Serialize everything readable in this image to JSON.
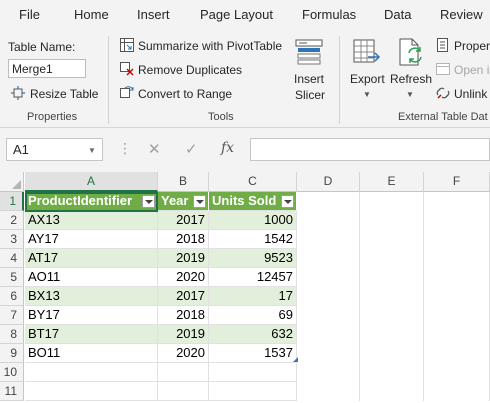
{
  "menu": {
    "file": "File",
    "home": "Home",
    "insert": "Insert",
    "page_layout": "Page Layout",
    "formulas": "Formulas",
    "data": "Data",
    "review": "Review"
  },
  "ribbon": {
    "properties": {
      "table_name_label": "Table Name:",
      "table_name_value": "Merge1",
      "resize_table": "Resize Table",
      "group_label": "Properties"
    },
    "tools": {
      "summarize": "Summarize with PivotTable",
      "remove_duplicates": "Remove Duplicates",
      "convert_to_range": "Convert to Range",
      "insert_slicer_line1": "Insert",
      "insert_slicer_line2": "Slicer",
      "group_label": "Tools"
    },
    "external": {
      "export": "Export",
      "refresh": "Refresh",
      "properties": "Proper",
      "open_in": "Open i",
      "unlink": "Unlink",
      "group_label": "External Table Dat"
    }
  },
  "formula_bar": {
    "name_box": "A1",
    "fx": "fx",
    "formula": ""
  },
  "grid": {
    "columns": [
      "A",
      "B",
      "C",
      "D",
      "E",
      "F"
    ],
    "rows": [
      "1",
      "2",
      "3",
      "4",
      "5",
      "6",
      "7",
      "8",
      "9",
      "10",
      "11"
    ],
    "table_headers": [
      "ProductIdentifier",
      "Year",
      "Units Sold"
    ],
    "table_rows": [
      [
        "AX13",
        "2017",
        "1000"
      ],
      [
        "AY17",
        "2018",
        "1542"
      ],
      [
        "AT17",
        "2019",
        "9523"
      ],
      [
        "AO11",
        "2020",
        "12457"
      ],
      [
        "BX13",
        "2017",
        "17"
      ],
      [
        "BY17",
        "2018",
        "69"
      ],
      [
        "BT17",
        "2019",
        "632"
      ],
      [
        "BO11",
        "2020",
        "1537"
      ]
    ]
  },
  "colors": {
    "table_header": "#70ad47",
    "table_band": "#e2efda",
    "accent": "#217346"
  }
}
